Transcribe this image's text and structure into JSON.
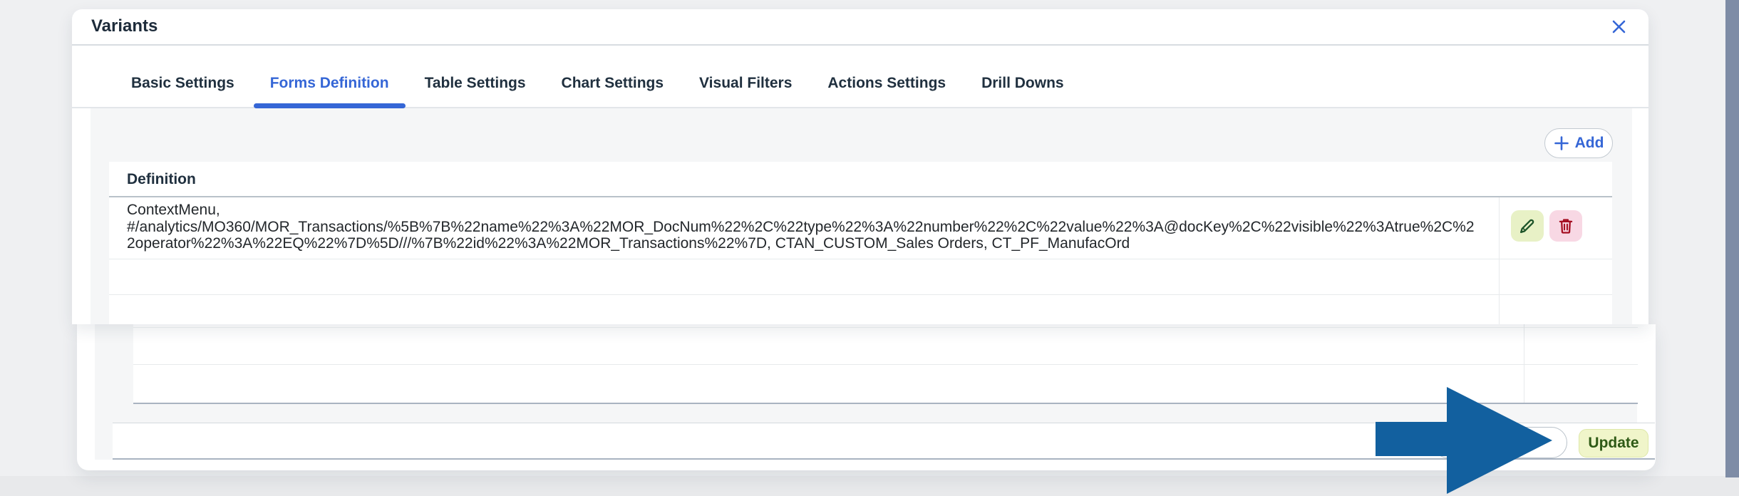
{
  "page": {
    "background": "#eff0f2",
    "bottom_strip_color": "#e8e9eb",
    "scrollbar_color": "#7e8ca6"
  },
  "dialog": {
    "title": "Variants",
    "accent_color": "#3566d6",
    "close_icon": "x-close",
    "tabs": [
      {
        "label": "Basic Settings",
        "active": false
      },
      {
        "label": "Forms Definition",
        "active": true
      },
      {
        "label": "Table Settings",
        "active": false
      },
      {
        "label": "Chart Settings",
        "active": false
      },
      {
        "label": "Visual Filters",
        "active": false
      },
      {
        "label": "Actions Settings",
        "active": false
      },
      {
        "label": "Drill Downs",
        "active": false
      }
    ],
    "toolbar": {
      "add_label": "Add",
      "add_icon": "plus"
    },
    "table": {
      "header": "Definition",
      "rows": [
        {
          "definition": "ContextMenu, #/analytics/MO360/MOR_Transactions/%5B%7B%22name%22%3A%22MOR_DocNum%22%2C%22type%22%3A%22number%22%2C%22value%22%3A@docKey%2C%22visible%22%3Atrue%2C%22operator%22%3A%22EQ%22%7D%5D///%7B%22id%22%3A%22MOR_Transactions%22%7D, CTAN_CUSTOM_Sales Orders, CT_PF_ManufacOrd"
        }
      ],
      "empty_rows_upper": 2,
      "empty_rows_lower": 3
    },
    "row_actions": {
      "edit_icon": "pencil",
      "edit_bg": "#e8f1c6",
      "edit_color": "#1d5429",
      "delete_icon": "trash",
      "delete_bg": "#f8d8e4",
      "delete_color": "#a50f22"
    },
    "footer": {
      "update_label": "Update",
      "update_bg": "#f0f5ca",
      "update_color": "#2f5a16"
    }
  },
  "annotation": {
    "arrow_color": "#12609f",
    "direction": "right",
    "points_at": "Update button"
  }
}
